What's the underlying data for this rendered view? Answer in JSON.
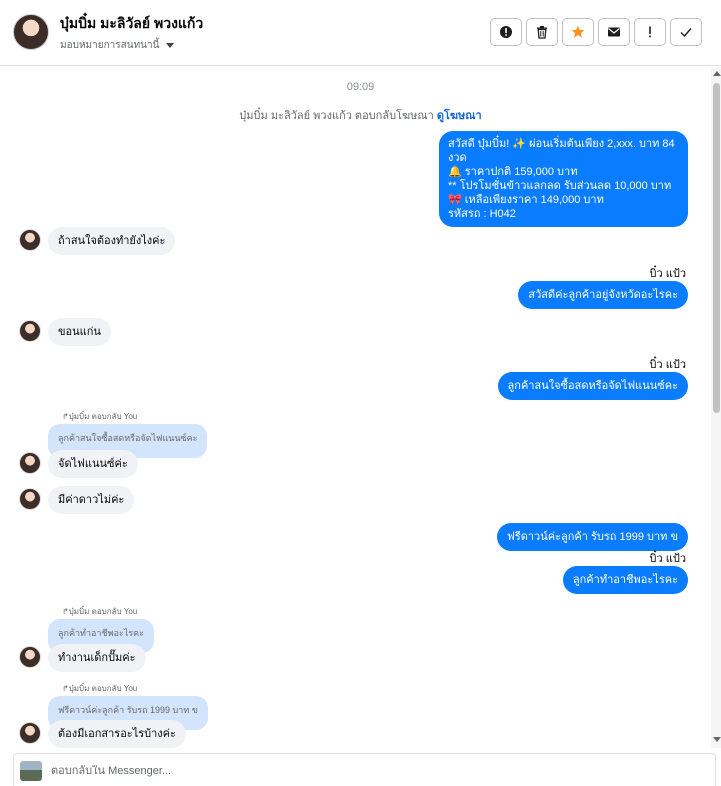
{
  "header": {
    "contact_name": "บุ๋มบิ๋ม มะลิวัลย์ พวงแก้ว",
    "assign_label": "มอบหมายการสนทนานี้",
    "tools": [
      {
        "name": "spam-alert",
        "icon": "alert-circle-icon"
      },
      {
        "name": "delete",
        "icon": "trash-icon"
      },
      {
        "name": "star",
        "icon": "star-icon"
      },
      {
        "name": "mark-unread",
        "icon": "envelope-icon"
      },
      {
        "name": "follow-up",
        "icon": "exclamation-icon"
      },
      {
        "name": "done",
        "icon": "check-icon"
      }
    ],
    "star_color": "#f7931e"
  },
  "chat": {
    "timestamp": "09:09",
    "sys_note_prefix": "บุ๋มบิ๋ม มะลิวัลย์ พวงแก้ว ตอบกลับโฆษณา",
    "sys_note_link": "ดูโฆษณา",
    "promo": [
      "สวัสดี บุ๋มบิ๋ม! ✨  ผ่อนเริ่มต้นเพียง 2,xxx. บาท 84 งวด",
      "🔔 ราคาปกติ  159,000 บาท",
      "** โปรโมชั่นข้าวแลกลด รับส่วนลด 10,000 บาท",
      "🎀  เหลือเพียงราคา 149,000 บาท",
      " รหัสรถ : H042"
    ],
    "msg_in_1": "ถ้าสนใจต้องทำยังไงค่ะ",
    "sender_1": "บิ๋ว แป้ว",
    "msg_out_1": "สวัสดีค่ะลูกค้าอยู่จังหวัดอะไรคะ",
    "msg_in_2": "ขอนแก่น",
    "sender_2": "บิ๋ว แป้ว",
    "msg_out_2": "ลูกค้าสนใจซื้อสดหรือจัดไฟแนนซ์คะ",
    "reply_label_1": "↱บุ๋มบิ๋ม ตอบกลับ You",
    "quote_1": "ลูกค้าสนใจซื้อสดหรือจัดไฟแนนซ์คะ",
    "msg_in_3": "จัดไฟแนนซ์ค่ะ",
    "msg_in_4": "มีค่าดาวไม่ค่ะ",
    "msg_out_3": "ฟรีดาวน์ค่ะลูกค้า  รับรถ 1999 บาท ข",
    "sender_3": "บิ๋ว แป้ว",
    "msg_out_4": "ลูกค้าทำอาชีพอะไรคะ",
    "reply_label_2": "↱บุ๋มบิ๋ม ตอบกลับ You",
    "quote_2": "ลูกค้าทำอาชีพอะไรคะ",
    "msg_in_5": "ทำงานเด็กปั๊มค่ะ",
    "reply_label_3": "↱บุ๋มบิ๋ม ตอบกลับ You",
    "quote_3": "ฟรีดาวน์ค่ะลูกค้า  รับรถ 1999 บาท ข",
    "msg_in_6": "ต้องมีเอกสารอะไรบ้างค่ะ"
  },
  "composer": {
    "placeholder": "ตอบกลับใน Messenger..."
  },
  "colors": {
    "outgoing_bubble": "#0a7cff",
    "incoming_bubble": "#f0f2f5",
    "quoted_bubble": "#d3e4fd",
    "link": "#1467d6"
  }
}
